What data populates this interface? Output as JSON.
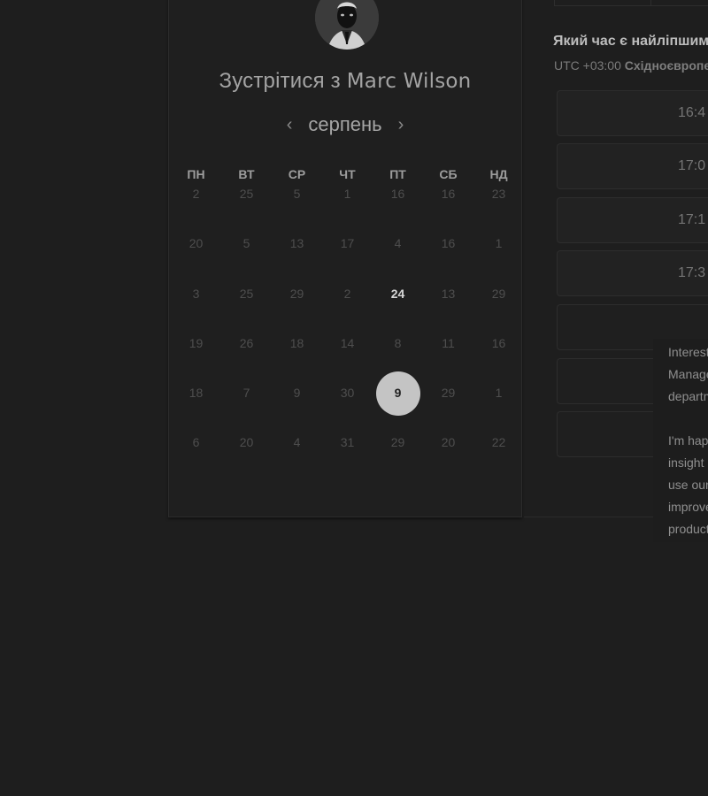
{
  "scheduler": {
    "title_prefix": "Зустрітися з",
    "host_name": "Marc Wilson",
    "month": "серпень",
    "prev_month_icon": "‹",
    "next_month_icon": "›",
    "weekdays": [
      "ПН",
      "ВТ",
      "СР",
      "ЧТ",
      "ПТ",
      "СБ",
      "НД"
    ],
    "weeks": [
      [
        "2",
        "25",
        "5",
        "1",
        "16",
        "16",
        "23"
      ],
      [
        "20",
        "5",
        "13",
        "17",
        "4",
        "16",
        "1"
      ],
      [
        "3",
        "25",
        "29",
        "2",
        "24",
        "13",
        "29"
      ],
      [
        "19",
        "26",
        "18",
        "14",
        "8",
        "11",
        "16"
      ],
      [
        "18",
        "7",
        "9",
        "30",
        "9",
        "29",
        "1"
      ],
      [
        "6",
        "20",
        "4",
        "31",
        "29",
        "20",
        "22"
      ]
    ],
    "available_day": "24",
    "selected_day": "9"
  },
  "time_panel": {
    "question": "Який час є найліпшим",
    "timezone_offset": "UTC +03:00",
    "timezone_name": "Східноєвропе",
    "slots": [
      "16:4",
      "17:0",
      "17:1",
      "17:3"
    ]
  },
  "bio": {
    "lines_1": [
      "Interest",
      "Manage",
      "departm"
    ],
    "lines_2": [
      "I'm hap",
      "insight",
      "use our",
      "improve",
      "product"
    ]
  },
  "colors": {
    "background": "#1e1e1e",
    "selected_day": "#c4c4c4",
    "text": "#9a9a9a"
  }
}
